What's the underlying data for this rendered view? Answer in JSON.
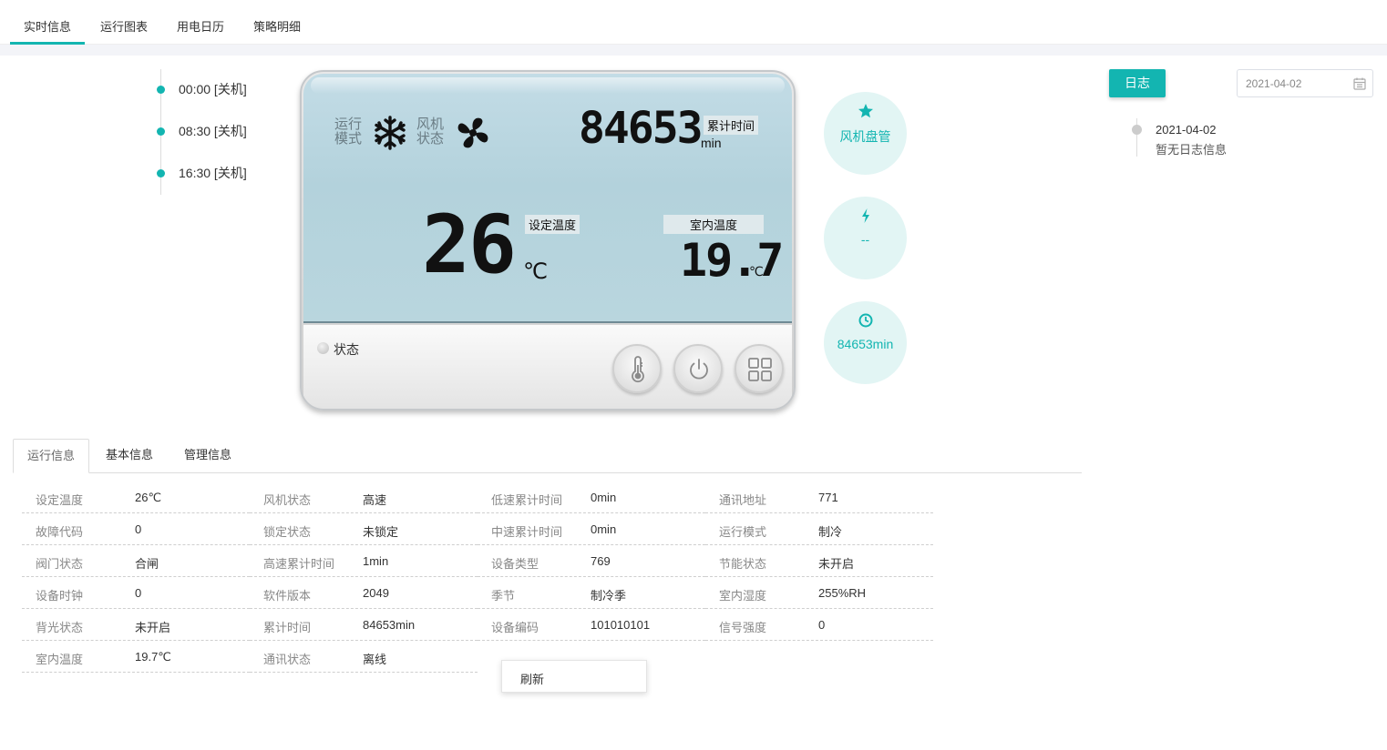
{
  "top_tabs": [
    {
      "label": "实时信息",
      "active": true
    },
    {
      "label": "运行图表"
    },
    {
      "label": "用电日历"
    },
    {
      "label": "策略明细"
    }
  ],
  "schedule": [
    {
      "text": "00:00 [关机]"
    },
    {
      "text": "08:30 [关机]"
    },
    {
      "text": "16:30 [关机]"
    }
  ],
  "device": {
    "mode_label_1": "运行",
    "mode_label_2": "模式",
    "fan_label_1": "风机",
    "fan_label_2": "状态",
    "mode_icon": "snowflake-icon",
    "fan_icon": "fan-icon",
    "accum_value": "84653",
    "accum_tag": "累计时间",
    "accum_unit": "min",
    "set_temp_value": "26",
    "set_temp_tag": "设定温度",
    "set_temp_unit": "℃",
    "room_temp_tag": "室内温度",
    "room_temp_value": "19.7",
    "room_temp_unit": "℃",
    "status_label": "状态",
    "buttons": [
      "thermometer-icon",
      "power-icon",
      "grid-icon"
    ]
  },
  "side_circles": [
    {
      "icon": "star-icon",
      "label": "风机盘管"
    },
    {
      "icon": "lightning-icon",
      "label": "--"
    },
    {
      "icon": "clock-icon",
      "label": "84653min"
    }
  ],
  "log": {
    "button_label": "日志",
    "date_value": "2021-04-02",
    "entry_date": "2021-04-02",
    "entry_message": "暂无日志信息"
  },
  "bottom_tabs": [
    {
      "label": "运行信息",
      "active": true
    },
    {
      "label": "基本信息"
    },
    {
      "label": "管理信息"
    }
  ],
  "info": {
    "rows": [
      [
        [
          "设定温度",
          "26℃"
        ],
        [
          "风机状态",
          "高速"
        ],
        [
          "低速累计时间",
          "0min"
        ],
        [
          "通讯地址",
          "771"
        ]
      ],
      [
        [
          "故障代码",
          "0"
        ],
        [
          "锁定状态",
          "未锁定"
        ],
        [
          "中速累计时间",
          "0min"
        ],
        [
          "运行模式",
          "制冷"
        ]
      ],
      [
        [
          "阀门状态",
          "合闸"
        ],
        [
          "高速累计时间",
          "1min"
        ],
        [
          "设备类型",
          "769"
        ],
        [
          "节能状态",
          "未开启"
        ]
      ],
      [
        [
          "设备时钟",
          "0"
        ],
        [
          "软件版本",
          "2049"
        ],
        [
          "季节",
          "制冷季"
        ],
        [
          "室内湿度",
          "255%RH"
        ]
      ],
      [
        [
          "背光状态",
          "未开启"
        ],
        [
          "累计时间",
          "84653min"
        ],
        [
          "设备编码",
          "101010101"
        ],
        [
          "信号强度",
          "0"
        ]
      ],
      [
        [
          "室内温度",
          "19.7℃"
        ],
        [
          "通讯状态",
          "离线"
        ]
      ]
    ]
  },
  "refresh_label": "刷新",
  "colors": {
    "accent": "#13b5b1",
    "accent_light": "#e2f5f4"
  }
}
